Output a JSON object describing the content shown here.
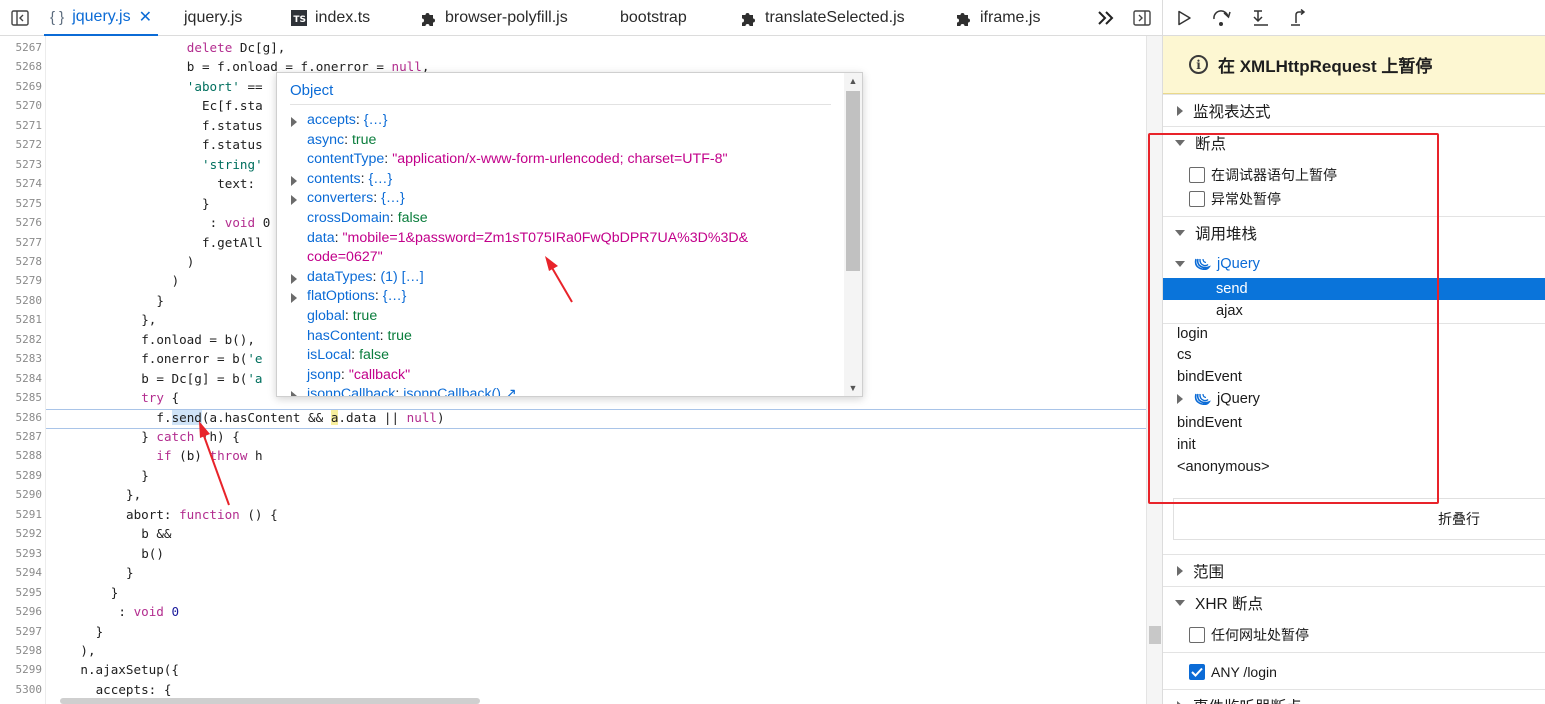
{
  "tabs": [
    {
      "label": "jquery.js",
      "active": true,
      "icon": "braces-icon",
      "closable": true
    },
    {
      "label": "jquery.js",
      "active": false,
      "icon": ""
    },
    {
      "label": "index.ts",
      "active": false,
      "icon": "ts-file-icon",
      "badge": "TS"
    },
    {
      "label": "browser-polyfill.js",
      "active": false,
      "icon": "puzzle-icon"
    },
    {
      "label": "bootstrap",
      "active": false,
      "icon": ""
    },
    {
      "label": "translateSelected.js",
      "active": false,
      "icon": "puzzle-icon"
    },
    {
      "label": "iframe.js",
      "active": false,
      "icon": "puzzle-icon"
    }
  ],
  "tab_extra": {
    "braces": "{ }",
    "close": "✕"
  },
  "code": {
    "current_line": 5286,
    "lines": [
      {
        "n": "5267",
        "indent": 18,
        "html": "<span class=\"kw\">delete</span> Dc[g],"
      },
      {
        "n": "5268",
        "indent": 18,
        "html": "b = f.onload = f.onerror = <span class=\"kw\">null</span>,"
      },
      {
        "n": "5269",
        "indent": 18,
        "html": "<span class=\"st\">'abort'</span> =="
      },
      {
        "n": "5270",
        "indent": 20,
        "html": "Ec[f.sta"
      },
      {
        "n": "5271",
        "indent": 20,
        "html": "f.status"
      },
      {
        "n": "5272",
        "indent": 20,
        "html": "f.status"
      },
      {
        "n": "5273",
        "indent": 20,
        "html": "<span class=\"st\">'string'</span>"
      },
      {
        "n": "5274",
        "indent": 22,
        "html": "text: "
      },
      {
        "n": "5275",
        "indent": 20,
        "html": "}"
      },
      {
        "n": "5276",
        "indent": 21,
        "html": ": <span class=\"kw\">void</span> 0"
      },
      {
        "n": "5277",
        "indent": 20,
        "html": "f.getAll"
      },
      {
        "n": "5278",
        "indent": 18,
        "html": ")"
      },
      {
        "n": "5279",
        "indent": 16,
        "html": ")"
      },
      {
        "n": "5280",
        "indent": 14,
        "html": "}"
      },
      {
        "n": "5281",
        "indent": 12,
        "html": "},"
      },
      {
        "n": "5282",
        "indent": 12,
        "html": "f.onload = b(),"
      },
      {
        "n": "5283",
        "indent": 12,
        "html": "f.onerror = b(<span class=\"st\">'e</span>"
      },
      {
        "n": "5284",
        "indent": 12,
        "html": "b = Dc[g] = b(<span class=\"st\">'a</span>"
      },
      {
        "n": "5285",
        "indent": 12,
        "html": "<span class=\"kw\">try</span> {"
      },
      {
        "n": "5286",
        "indent": 14,
        "html": "f.<span class=\"hl-send\">send</span>(a.hasContent &amp;&amp; <span class=\"hl-a\">a</span>.data || <span class=\"kw\">null</span>)"
      },
      {
        "n": "5287",
        "indent": 12,
        "html": "} <span class=\"kw\">catch</span> (h) {"
      },
      {
        "n": "5288",
        "indent": 14,
        "html": "<span class=\"kw\">if</span> (b) <span class=\"kw\">throw</span> h"
      },
      {
        "n": "5289",
        "indent": 12,
        "html": "}"
      },
      {
        "n": "5290",
        "indent": 10,
        "html": "},"
      },
      {
        "n": "5291",
        "indent": 10,
        "html": "abort: <span class=\"kw\">function</span> () {"
      },
      {
        "n": "5292",
        "indent": 12,
        "html": "b &amp;&amp;"
      },
      {
        "n": "5293",
        "indent": 12,
        "html": "b()"
      },
      {
        "n": "5294",
        "indent": 10,
        "html": "}"
      },
      {
        "n": "5295",
        "indent": 8,
        "html": "}"
      },
      {
        "n": "5296",
        "indent": 9,
        "html": ": <span class=\"kw\">void</span> <span class=\"nm\">0</span>"
      },
      {
        "n": "5297",
        "indent": 6,
        "html": "}"
      },
      {
        "n": "5298",
        "indent": 4,
        "html": "),"
      },
      {
        "n": "5299",
        "indent": 4,
        "html": "n.ajaxSetup({"
      },
      {
        "n": "5300",
        "indent": 6,
        "html": "accepts: {"
      }
    ]
  },
  "popup": {
    "title": "Object",
    "rows": [
      {
        "key": "accepts",
        "value": "{…}",
        "vtype": "obj",
        "expandable": true
      },
      {
        "key": "async",
        "value": "true",
        "vtype": "bool",
        "expandable": false
      },
      {
        "key": "contentType",
        "value": "\"application/x-www-form-urlencoded; charset=UTF-8\"",
        "vtype": "str",
        "expandable": false
      },
      {
        "key": "contents",
        "value": "{…}",
        "vtype": "obj",
        "expandable": true
      },
      {
        "key": "converters",
        "value": "{…}",
        "vtype": "obj",
        "expandable": true
      },
      {
        "key": "crossDomain",
        "value": "false",
        "vtype": "bool",
        "expandable": false
      },
      {
        "key": "data",
        "value": "\"mobile=1&password=Zm1sT075IRa0FwQbDPR7UA%3D%3D&",
        "vtype": "str",
        "expandable": false
      },
      {
        "key": "",
        "value": "code=0627\"",
        "vtype": "str",
        "expandable": false,
        "continuation": true
      },
      {
        "key": "dataTypes",
        "value": "(1) […]",
        "vtype": "obj",
        "expandable": true
      },
      {
        "key": "flatOptions",
        "value": "{…}",
        "vtype": "obj",
        "expandable": true
      },
      {
        "key": "global",
        "value": "true",
        "vtype": "bool",
        "expandable": false
      },
      {
        "key": "hasContent",
        "value": "true",
        "vtype": "bool",
        "expandable": false
      },
      {
        "key": "isLocal",
        "value": "false",
        "vtype": "bool",
        "expandable": false
      },
      {
        "key": "jsonp",
        "value": "\"callback\"",
        "vtype": "str",
        "expandable": false
      },
      {
        "key": "jsonpCallback",
        "value": "jsonpCallback() ↗",
        "vtype": "obj",
        "expandable": true
      }
    ]
  },
  "debugger": {
    "toolbar": [
      "resume-icon",
      "step-over-icon",
      "step-in-icon",
      "step-out-icon"
    ],
    "pause_banner": "在 XMLHttpRequest 上暂停",
    "sections": {
      "watch": "监视表达式",
      "breakpoints": "断点",
      "callstack": "调用堆栈",
      "scopes": "范围",
      "xhr": "XHR 断点"
    },
    "bp_options": [
      {
        "label": "在调试器语句上暂停",
        "checked": false
      },
      {
        "label": "异常处暂停",
        "checked": false
      }
    ],
    "callstack": {
      "group1": "jQuery",
      "group1_frames": [
        "send",
        "ajax"
      ],
      "frames_after": [
        "login",
        "cs",
        "bindEvent"
      ],
      "group2": "jQuery",
      "frames_tail": [
        "bindEvent",
        "init",
        "<anonymous>"
      ],
      "collapse": "折叠行"
    },
    "xhr_options": [
      {
        "label": "任何网址处暂停",
        "checked": false
      },
      {
        "label": "ANY /login",
        "checked": true
      }
    ],
    "last_partial": "事件监听器断点"
  },
  "colors": {
    "accent": "#0b6bd6",
    "selected": "#0a74da",
    "annotation": "#e8232a",
    "banner": "#fdf7d2"
  }
}
